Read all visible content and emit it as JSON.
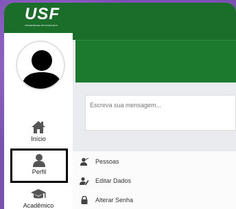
{
  "logo": {
    "text": "USF",
    "subtext": "UNIVERSIDADE SÃO FRANCISCO"
  },
  "nav": {
    "inicio": "Início",
    "perfil": "Perfil",
    "academico": "Acadêmico"
  },
  "composer": {
    "placeholder": "Escreva sua mensagem..."
  },
  "submenu": {
    "items": [
      "Pessoas",
      "Editar Dados",
      "Alterar Senha"
    ]
  },
  "colors": {
    "brand_green": "#1a6e2a",
    "background_purple": "#7b50b3"
  }
}
